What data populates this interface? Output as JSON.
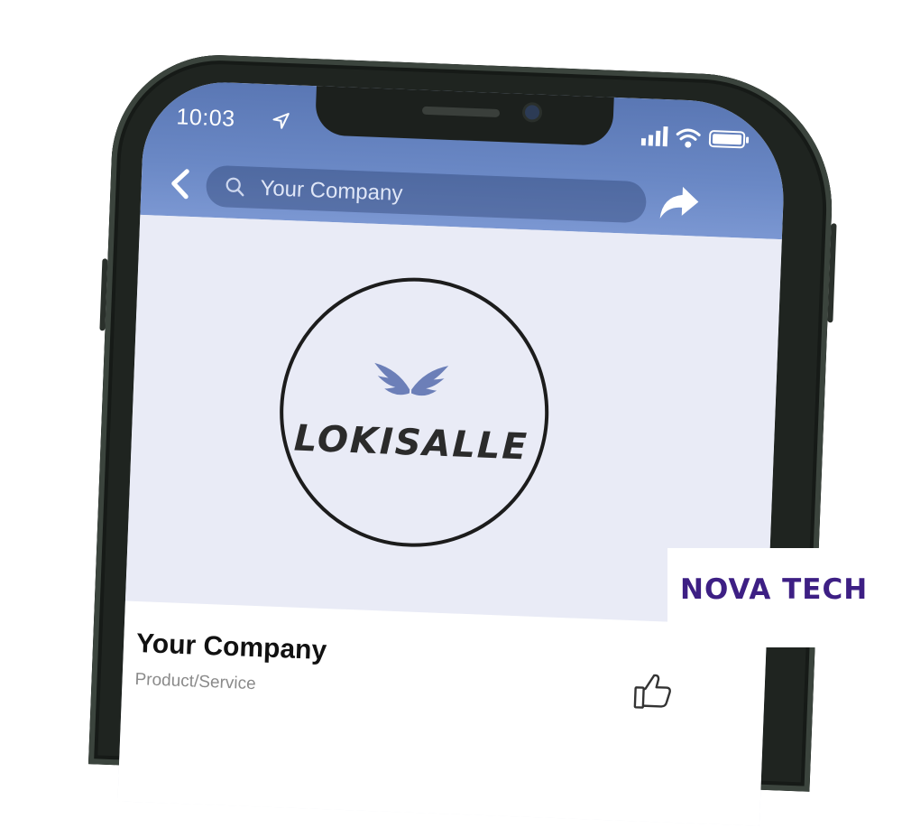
{
  "status_bar": {
    "time": "10:03",
    "icons": [
      "location-arrow-icon",
      "signal-icon",
      "wifi-icon",
      "battery-icon"
    ]
  },
  "nav": {
    "search_text": "Your Company",
    "back_icon": "chevron-left-icon",
    "share_icon": "share-arrow-icon"
  },
  "cover": {
    "logo_text": "LOKISALLE"
  },
  "profile": {
    "name": "Your Company",
    "category": "Product/Service",
    "like_icon": "thumbs-up-icon"
  },
  "watermark": {
    "part1": "NOVA",
    "part2": "TECH"
  },
  "colors": {
    "navbar": "#6a88c5",
    "cover_bg": "#e9ebf6",
    "watermark": "#3d1f84"
  }
}
